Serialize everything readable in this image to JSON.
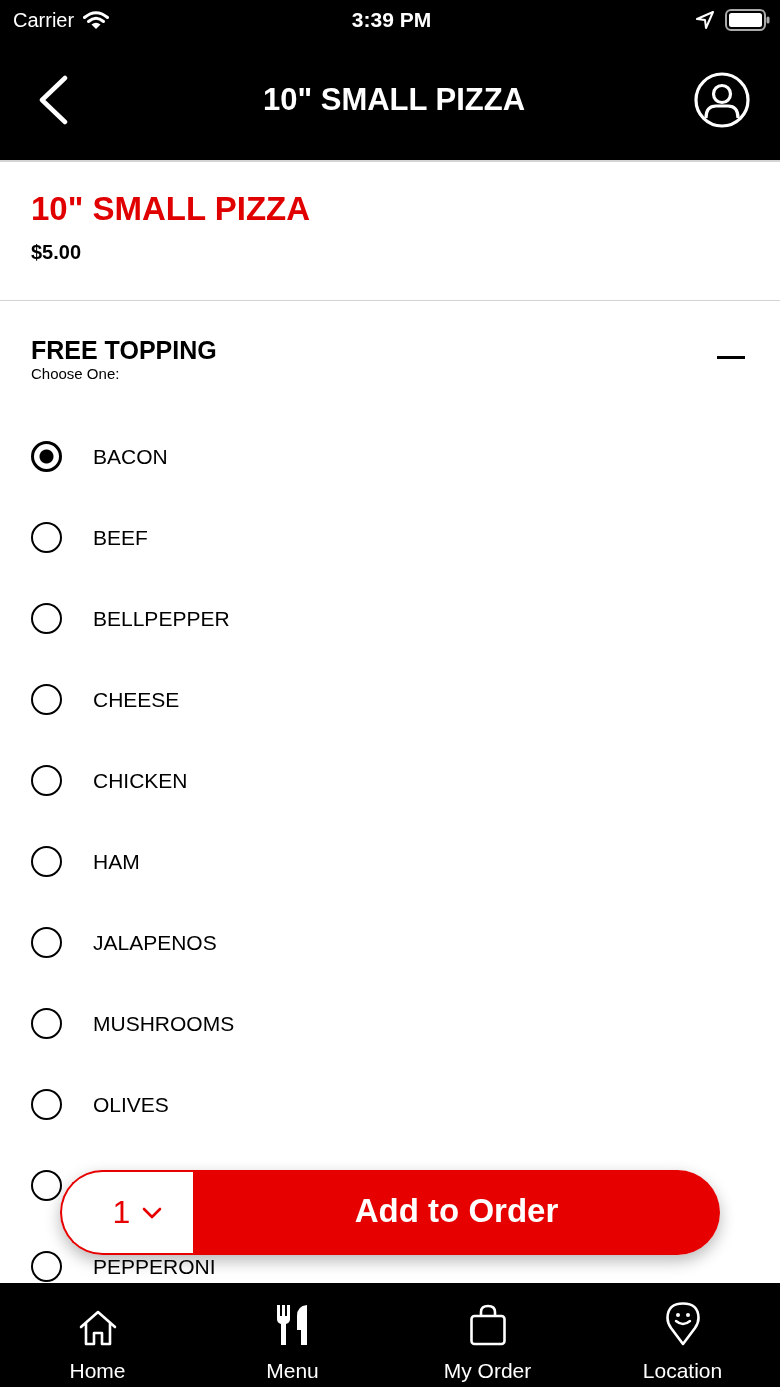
{
  "status_bar": {
    "carrier": "Carrier",
    "time": "3:39 PM"
  },
  "nav_bar": {
    "title": "10\" SMALL PIZZA"
  },
  "product": {
    "name": "10\" SMALL PIZZA",
    "price": "$5.00"
  },
  "option_group": {
    "title": "FREE TOPPING",
    "subtitle": "Choose One:",
    "expanded": true,
    "options": [
      {
        "label": "BACON",
        "selected": true
      },
      {
        "label": "BEEF",
        "selected": false
      },
      {
        "label": "BELLPEPPER",
        "selected": false
      },
      {
        "label": "CHEESE",
        "selected": false
      },
      {
        "label": "CHICKEN",
        "selected": false
      },
      {
        "label": "HAM",
        "selected": false
      },
      {
        "label": "JALAPENOS",
        "selected": false
      },
      {
        "label": "MUSHROOMS",
        "selected": false
      },
      {
        "label": "OLIVES",
        "selected": false
      },
      {
        "selected": false
      },
      {
        "label": "PEPPERONI",
        "selected": false
      }
    ]
  },
  "order_bar": {
    "quantity": "1",
    "button": "Add to Order"
  },
  "tab_bar": {
    "tabs": [
      {
        "label": "Home"
      },
      {
        "label": "Menu"
      },
      {
        "label": "My Order"
      },
      {
        "label": "Location"
      }
    ]
  }
}
